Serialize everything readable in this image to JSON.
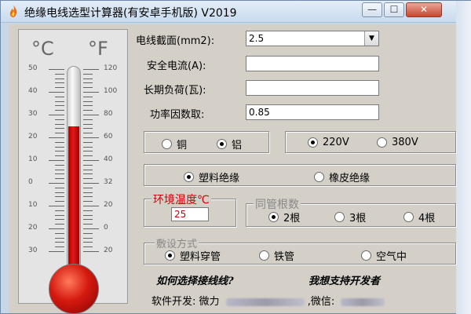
{
  "window": {
    "title": "绝缘电线选型计算器(有安卓手机版) V2019",
    "min_glyph": "—",
    "max_glyph": "☐",
    "close_glyph": "✕"
  },
  "thermometer": {
    "celsius_label": "°C",
    "fahrenheit_label": "°F",
    "celsius_ticks": [
      "50",
      "40",
      "30",
      "20",
      "10",
      "0",
      "10",
      "20",
      "30"
    ],
    "fahrenheit_ticks": [
      "120",
      "100",
      "80",
      "60",
      "40",
      "32",
      "20",
      "0",
      "20"
    ],
    "level_celsius": 25,
    "scale_celsius": [
      -30,
      50
    ]
  },
  "form": {
    "section_label": "电线截面(mm2):",
    "section_value": "2.5",
    "current_label": "安全电流(A):",
    "current_value": "",
    "load_label": "长期负荷(瓦):",
    "load_value": "",
    "pf_label": "功率因数取:",
    "pf_value": "0.85"
  },
  "material": {
    "copper": "铜",
    "aluminum": "铝",
    "selected": "aluminum"
  },
  "voltage": {
    "v220": "220V",
    "v380": "380V",
    "selected": "220V"
  },
  "insulation": {
    "plastic": "塑料绝缘",
    "rubber": "橡皮绝缘",
    "selected": "plastic"
  },
  "ambient": {
    "label": "环境温度℃",
    "value": "25"
  },
  "conduits": {
    "label": "同管根数",
    "two": "2根",
    "three": "3根",
    "four": "4根",
    "selected": "two"
  },
  "laying": {
    "label": "敷设方式",
    "plastic_tube": "塑料穿管",
    "iron_tube": "铁管",
    "air": "空气中",
    "selected": "plastic_tube"
  },
  "links": {
    "how_to_choose": "如何选择接线线?",
    "support_dev": "我想支持开发者"
  },
  "footer": {
    "dev_label": "软件开发: 微力",
    "wechat_label": ",微信:"
  },
  "colors": {
    "mercury": "#d01010",
    "accent_red": "#cc0000",
    "panel": "#d4d0c8",
    "frame": "#c7d7e8"
  }
}
